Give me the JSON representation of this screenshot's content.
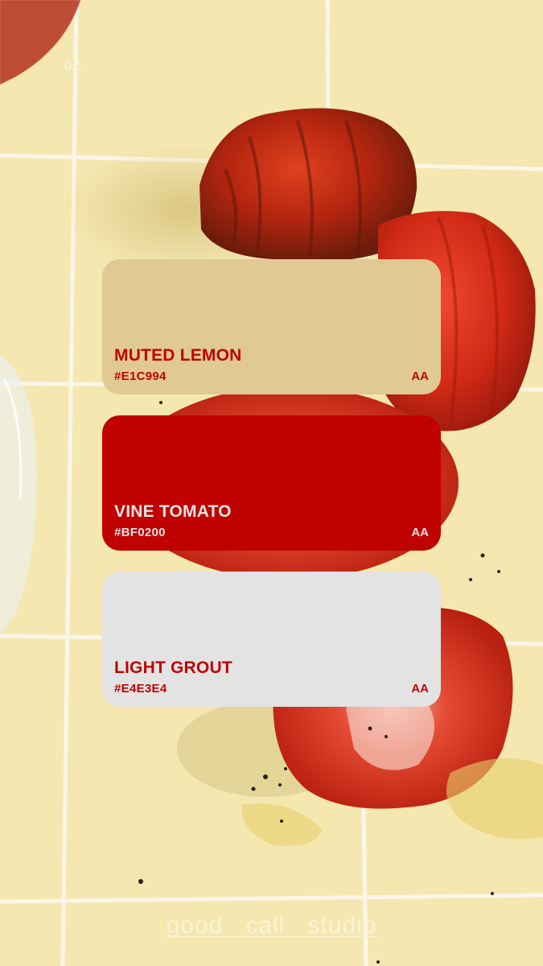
{
  "page_number": "02.",
  "swatches": [
    {
      "name": "MUTED LEMON",
      "hex": "#E1C994",
      "rating": "AA",
      "fill": "#E1C994",
      "text_color": "#BF0200"
    },
    {
      "name": "VINE TOMATO",
      "hex": "#BF0200",
      "rating": "AA",
      "fill": "#BF0200",
      "text_color": "#E4E3E4"
    },
    {
      "name": "LIGHT GROUT",
      "hex": "#E4E3E4",
      "rating": "AA",
      "fill": "#E4E3E4",
      "text_color": "#BF0200"
    }
  ],
  "brand": "good   call   studio",
  "colors": {
    "tile": "#F3E6AD",
    "grout": "#FBF5E6",
    "tomato_dark": "#7A1F10",
    "tomato_red": "#D0261A"
  }
}
